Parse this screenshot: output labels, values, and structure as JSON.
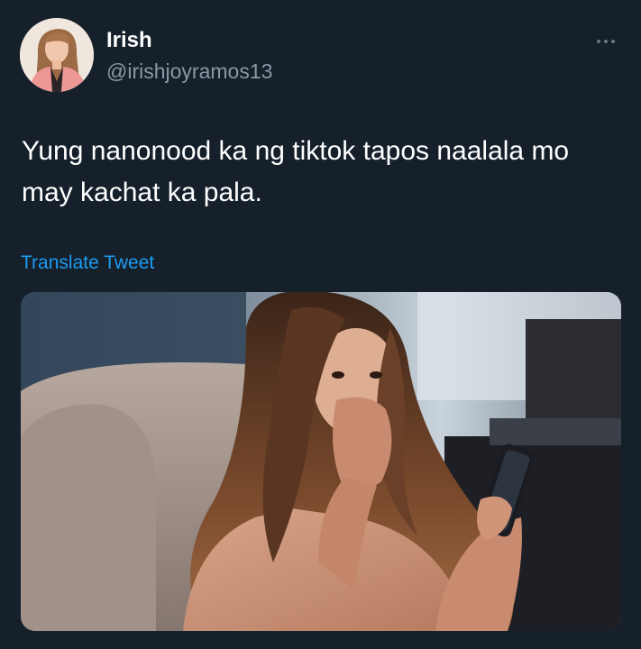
{
  "tweet": {
    "display_name": "Irish",
    "handle": "@irishjoyramos13",
    "text": "Yung nanonood ka ng tiktok tapos naalala mo\nmay kachat ka pala.",
    "translate_label": "Translate Tweet",
    "more_icon": "more-horizontal-icon"
  },
  "colors": {
    "background": "#15202b",
    "primary_text": "#ffffff",
    "secondary_text": "#8b98a5",
    "link": "#1d9bf0"
  }
}
